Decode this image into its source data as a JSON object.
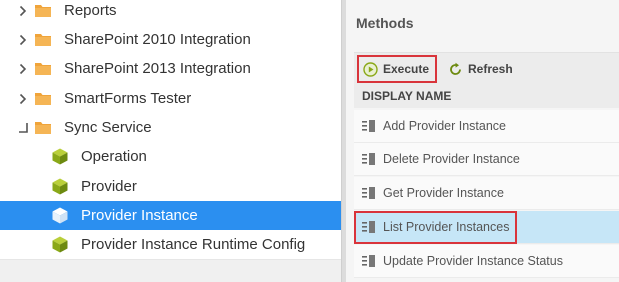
{
  "tree": {
    "items": [
      {
        "label": "Reports",
        "type": "folder",
        "expander": "collapsed"
      },
      {
        "label": "SharePoint 2010 Integration",
        "type": "folder",
        "expander": "collapsed"
      },
      {
        "label": "SharePoint 2013 Integration",
        "type": "folder",
        "expander": "collapsed"
      },
      {
        "label": "SmartForms Tester",
        "type": "folder",
        "expander": "collapsed"
      },
      {
        "label": "Sync Service",
        "type": "folder",
        "expander": "expanded"
      },
      {
        "label": "Operation",
        "type": "object"
      },
      {
        "label": "Provider",
        "type": "object"
      },
      {
        "label": "Provider Instance",
        "type": "object",
        "selected": true
      },
      {
        "label": "Provider Instance Runtime Config",
        "type": "object"
      }
    ]
  },
  "methods": {
    "title": "Methods",
    "toolbar": {
      "execute_label": "Execute",
      "refresh_label": "Refresh"
    },
    "column_header": "DISPLAY NAME",
    "rows": [
      {
        "label": "Add Provider Instance"
      },
      {
        "label": "Delete Provider Instance"
      },
      {
        "label": "Get Provider Instance"
      },
      {
        "label": "List Provider Instances",
        "selected": true
      },
      {
        "label": "Update Provider Instance Status"
      }
    ]
  },
  "colors": {
    "selection_blue": "#2b8ff0",
    "row_selected": "#c6e6f7",
    "highlight_red": "#d9343b",
    "folder": "#f0a43a",
    "object_cube": "#8aa818"
  }
}
